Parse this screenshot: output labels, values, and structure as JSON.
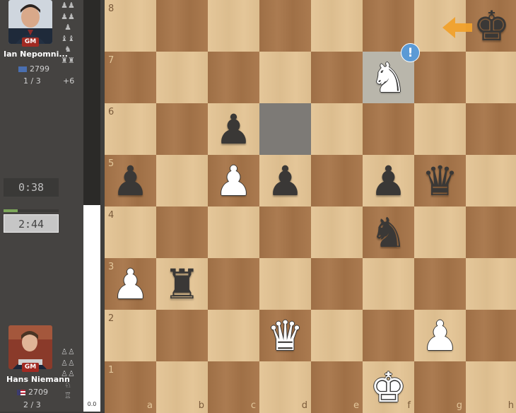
{
  "top_player": {
    "name": "Ian Nepomni...",
    "title": "GM",
    "rating": "2799",
    "score": "1 / 3",
    "advantage": "+6",
    "captured_icons": [
      "♟♟",
      "♟♟",
      "♟",
      "♝♝",
      "♞",
      "♜♜"
    ]
  },
  "bottom_player": {
    "name": "Hans Niemann",
    "title": "GM",
    "rating": "2709",
    "score": "2 / 3",
    "captured_icons": [
      "♙♙",
      "♙♙",
      "♙♙",
      "♘",
      "♖"
    ]
  },
  "clocks": {
    "top": "0:38",
    "bottom": "2:44"
  },
  "eval": {
    "value": "0.0"
  },
  "board": {
    "ranks": [
      "8",
      "7",
      "6",
      "5",
      "4",
      "3",
      "2",
      "1"
    ],
    "files": [
      "a",
      "b",
      "c",
      "d",
      "e",
      "f",
      "g",
      "h"
    ],
    "light_color": "#e3c393",
    "dark_color": "#a8764a",
    "highlight_from": "d6",
    "highlight_to": "f7",
    "annotation": {
      "square": "f7",
      "symbol": "!"
    },
    "pieces": [
      {
        "square": "h8",
        "glyph": "♚",
        "color": "black",
        "name": "king"
      },
      {
        "square": "f7",
        "glyph": "♞",
        "color": "white",
        "name": "knight"
      },
      {
        "square": "c6",
        "glyph": "♟",
        "color": "black",
        "name": "pawn"
      },
      {
        "square": "a5",
        "glyph": "♟",
        "color": "black",
        "name": "pawn"
      },
      {
        "square": "c5",
        "glyph": "♟",
        "color": "white",
        "name": "pawn"
      },
      {
        "square": "d5",
        "glyph": "♟",
        "color": "black",
        "name": "pawn"
      },
      {
        "square": "f5",
        "glyph": "♟",
        "color": "black",
        "name": "pawn"
      },
      {
        "square": "g5",
        "glyph": "♛",
        "color": "black",
        "name": "queen"
      },
      {
        "square": "f4",
        "glyph": "♞",
        "color": "black",
        "name": "knight"
      },
      {
        "square": "a3",
        "glyph": "♟",
        "color": "white",
        "name": "pawn"
      },
      {
        "square": "b3",
        "glyph": "♜",
        "color": "black",
        "name": "rook"
      },
      {
        "square": "d2",
        "glyph": "♛",
        "color": "white",
        "name": "queen"
      },
      {
        "square": "g2",
        "glyph": "♟",
        "color": "white",
        "name": "pawn"
      },
      {
        "square": "f1",
        "glyph": "♚",
        "color": "white",
        "name": "king"
      }
    ]
  }
}
